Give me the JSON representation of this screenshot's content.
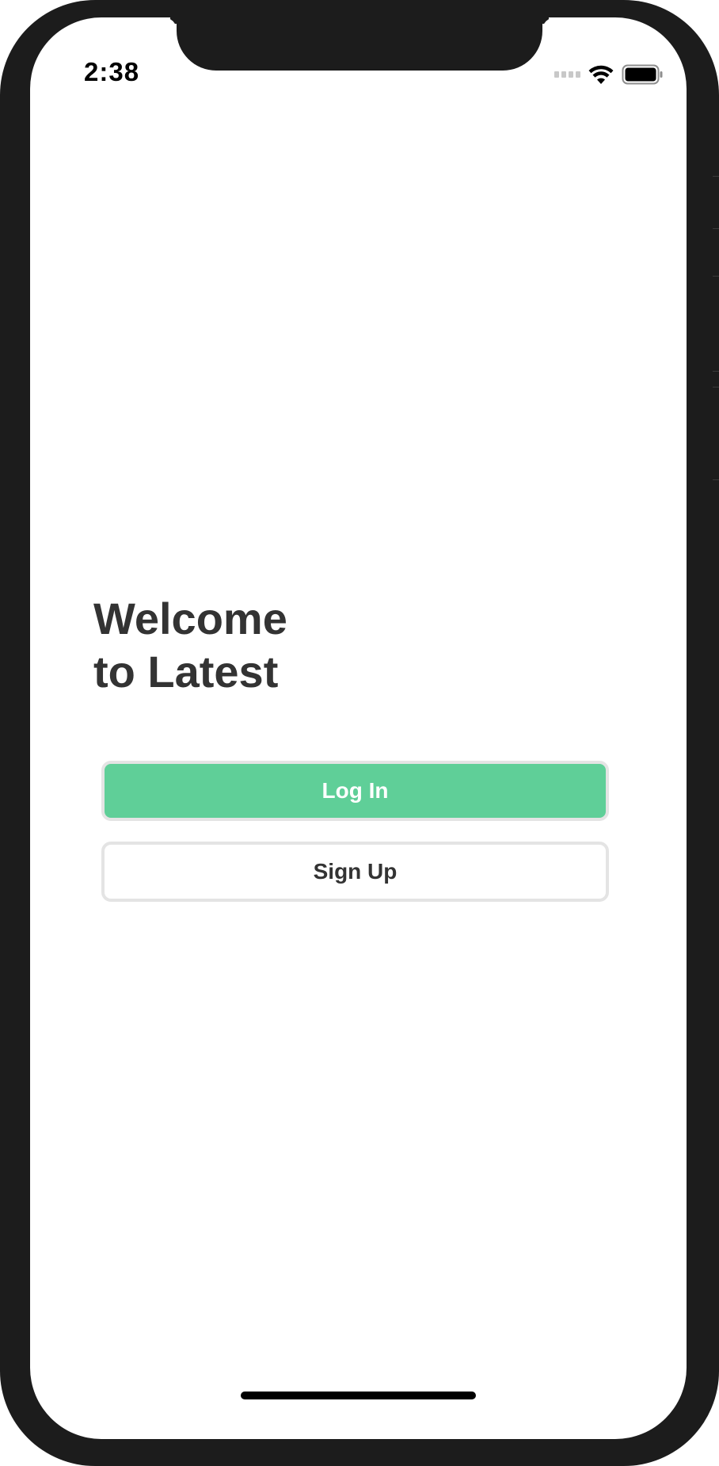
{
  "status_bar": {
    "time": "2:38",
    "signal_icon": "cellular-signal-icon",
    "wifi_icon": "wifi-icon",
    "battery_icon": "battery-icon"
  },
  "welcome": {
    "line1": "Welcome",
    "line2": "to Latest"
  },
  "buttons": {
    "login_label": "Log In",
    "signup_label": "Sign Up"
  },
  "colors": {
    "accent": "#5fcf98",
    "text": "#333333",
    "button_border": "#e4e4e4",
    "device_frame": "#1c1c1c"
  }
}
